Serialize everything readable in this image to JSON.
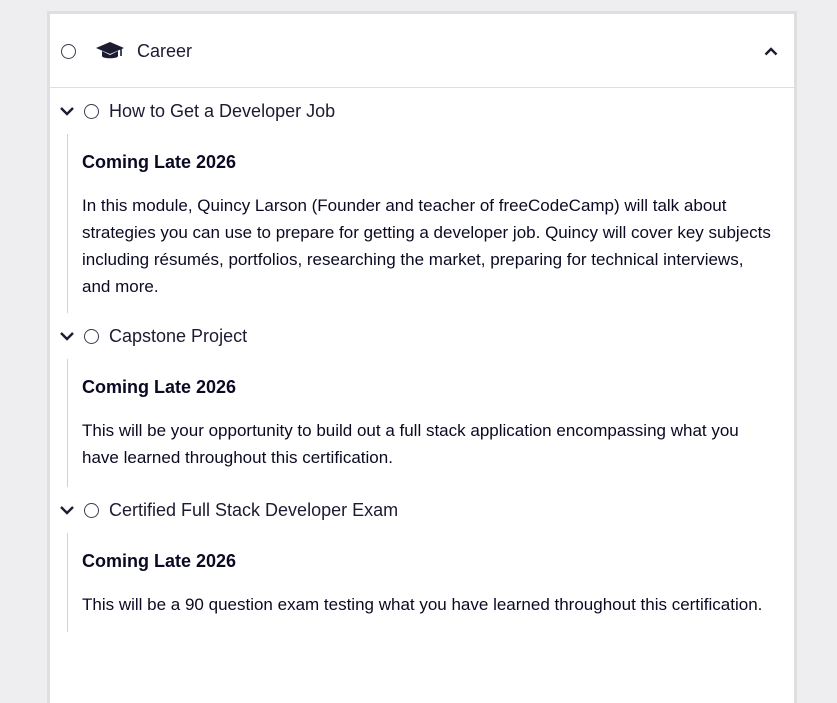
{
  "block": {
    "title": "Career",
    "icon": "graduation-cap-icon",
    "collapse_icon": "chevron-up-icon"
  },
  "modules": [
    {
      "title": "How to Get a Developer Job",
      "status": "Coming Late 2026",
      "description": "In this module, Quincy Larson (Founder and teacher of freeCodeCamp) will talk about strategies you can use to prepare for getting a developer job. Quincy will cover key subjects including résumés, portfolios, researching the market, preparing for technical interviews, and more."
    },
    {
      "title": "Capstone Project",
      "status": "Coming Late 2026",
      "description": "This will be your opportunity to build out a full stack application encompassing what you have learned throughout this certification."
    },
    {
      "title": "Certified Full Stack Developer Exam",
      "status": "Coming Late 2026",
      "description": "This will be a 90 question exam testing what you have learned throughout this certification."
    }
  ],
  "colors": {
    "page_bg": "#eeeef0",
    "panel_bg": "#ffffff",
    "border": "#dfdfe2",
    "text": "#0a0a23"
  }
}
